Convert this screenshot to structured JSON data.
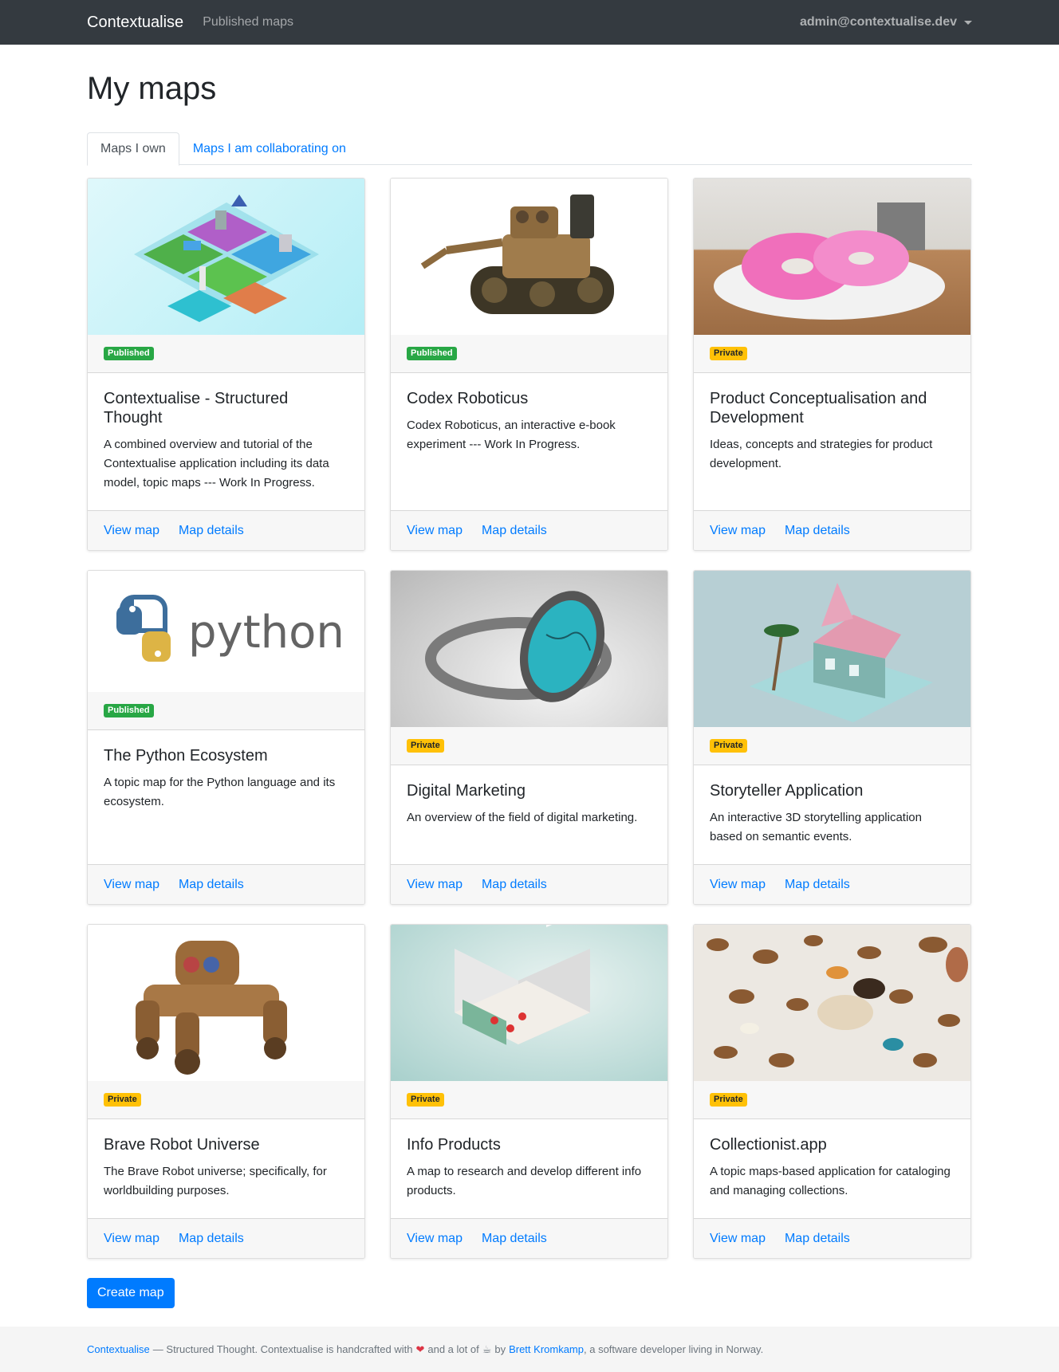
{
  "navbar": {
    "brand": "Contextualise",
    "published_maps": "Published maps",
    "user": "admin@contextualise.dev"
  },
  "page_title": "My maps",
  "tabs": [
    {
      "label": "Maps I own",
      "active": true
    },
    {
      "label": "Maps I am collaborating on",
      "active": false
    }
  ],
  "cards": [
    {
      "status": "Published",
      "title": "Contextualise - Structured Thought",
      "description": "A combined overview and tutorial of the Contextualise application including its data model, topic maps --- Work In Progress.",
      "view": "View map",
      "details": "Map details",
      "image": "isometric-islands"
    },
    {
      "status": "Published",
      "title": "Codex Roboticus",
      "description": "Codex Roboticus, an interactive e-book experiment --- Work In Progress.",
      "view": "View map",
      "details": "Map details",
      "image": "tank-robot"
    },
    {
      "status": "Private",
      "title": "Product Conceptualisation and Development",
      "description": "Ideas, concepts and strategies for product development.",
      "view": "View map",
      "details": "Map details",
      "image": "donuts"
    },
    {
      "status": "Published",
      "title": "The Python Ecosystem",
      "description": "A topic map for the Python language and its ecosystem.",
      "view": "View map",
      "details": "Map details",
      "image": "python-logo",
      "logo_text": "python"
    },
    {
      "status": "Private",
      "title": "Digital Marketing",
      "description": "An overview of the field of digital marketing.",
      "view": "View map",
      "details": "Map details",
      "image": "turquoise-ring"
    },
    {
      "status": "Private",
      "title": "Storyteller Application",
      "description": "An interactive 3D storytelling application based on semantic events.",
      "view": "View map",
      "details": "Map details",
      "image": "pink-house"
    },
    {
      "status": "Private",
      "title": "Brave Robot Universe",
      "description": "The Brave Robot universe; specifically, for worldbuilding purposes.",
      "view": "View map",
      "details": "Map details",
      "image": "wheeled-robot"
    },
    {
      "status": "Private",
      "title": "Info Products",
      "description": "A map to research and develop different info products.",
      "view": "View map",
      "details": "Map details",
      "image": "isometric-office"
    },
    {
      "status": "Private",
      "title": "Collectionist.app",
      "description": "A topic maps-based application for cataloging and managing collections.",
      "view": "View map",
      "details": "Map details",
      "image": "butterflies"
    }
  ],
  "create_button": "Create map",
  "footer": {
    "brand_link": "Contextualise",
    "text1": "— Structured Thought. Contextualise is handcrafted with",
    "text2": "and a lot of",
    "text3": "by",
    "author_link": "Brett Kromkamp",
    "text4": ", a software developer living in Norway."
  },
  "colors": {
    "navbar": "#343a40",
    "primary": "#007bff",
    "published_badge": "#28a745",
    "private_badge": "#ffc107"
  }
}
